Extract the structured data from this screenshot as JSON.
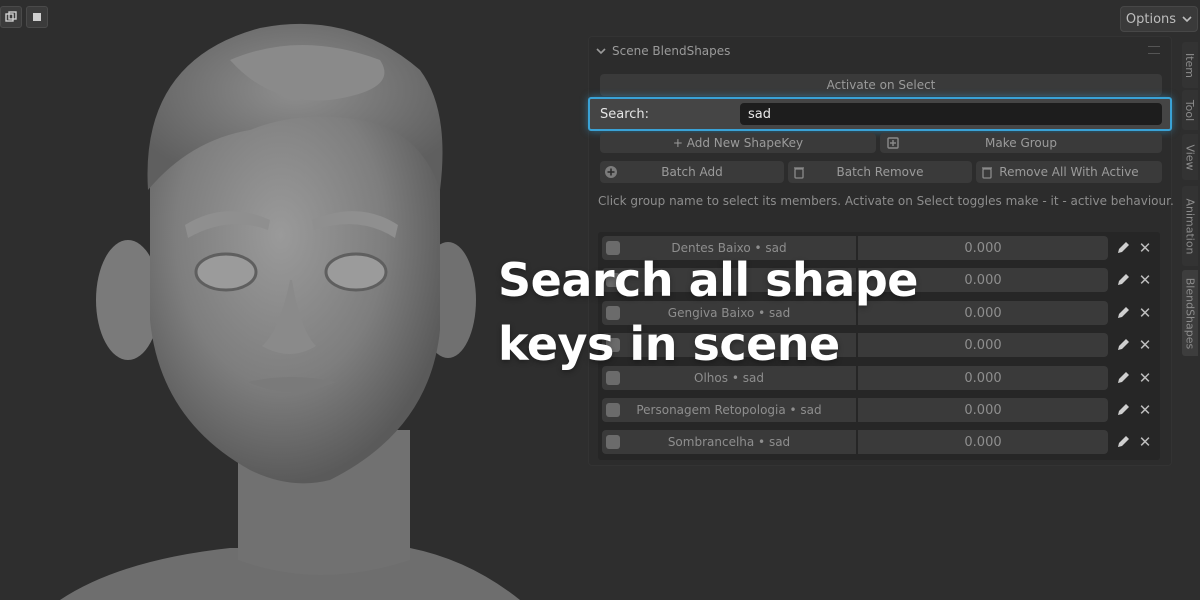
{
  "header": {
    "options_label": "Options"
  },
  "panel": {
    "title": "Scene BlendShapes",
    "activate_on_select": "Activate on Select",
    "search": {
      "label": "Search:",
      "value": "sad"
    },
    "add_new_shapekey": "+ Add New ShapeKey",
    "make_group": "Make Group",
    "batch_add": "Batch Add",
    "batch_remove": "Batch Remove",
    "remove_all_with_active": "Remove All With Active",
    "hint": "Click group name to select its members. Activate on Select toggles make - it - active behaviour.",
    "rows": [
      {
        "name": "Dentes Baixo • sad",
        "value": "0.000"
      },
      {
        "name": "",
        "value": "0.000"
      },
      {
        "name": "Gengiva Baixo • sad",
        "value": "0.000"
      },
      {
        "name": "",
        "value": "0.000"
      },
      {
        "name": "Olhos • sad",
        "value": "0.000"
      },
      {
        "name": "Personagem Retopologia • sad",
        "value": "0.000"
      },
      {
        "name": "Sombrancelha • sad",
        "value": "0.000"
      }
    ]
  },
  "side_tabs": [
    "Item",
    "Tool",
    "View",
    "Animation",
    "BlendShapes"
  ],
  "headline": {
    "line1": "Search all shape",
    "line2": "keys in scene"
  },
  "colors": {
    "accent": "#3aa2d6",
    "panel_bg": "#2c2c2c",
    "viewport_bg": "#2e2e2e"
  }
}
